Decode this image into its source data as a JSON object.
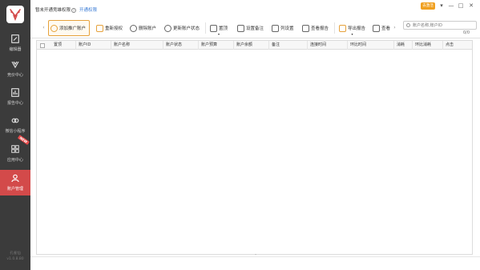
{
  "sidebar": {
    "items": [
      {
        "label": "编辑器",
        "icon": "edit-icon"
      },
      {
        "label": "竞价中心",
        "icon": "bid-icon"
      },
      {
        "label": "报告中心",
        "icon": "report-icon"
      },
      {
        "label": "微信小程序",
        "icon": "wechat-icon"
      },
      {
        "label": "应用中心",
        "icon": "apps-icon",
        "badge": "NEW"
      },
      {
        "label": "账户管理",
        "icon": "account-icon",
        "active": true
      }
    ],
    "footer_name": "孔雀仙",
    "version": "v1.0.8.80"
  },
  "header": {
    "notice": "暂未开通竞雄权限",
    "notice_link": "开通权限",
    "vip_label": "去激活",
    "window_controls": [
      "▾",
      "—",
      "□",
      "✕"
    ]
  },
  "toolbar": {
    "buttons": [
      {
        "label": "添加推广账户",
        "icon": "user-add-icon"
      },
      {
        "label": "重新授权",
        "icon": "reauth-icon"
      },
      {
        "label": "删除账户",
        "icon": "delete-icon"
      },
      {
        "label": "更新账户状态",
        "icon": "refresh-icon"
      },
      {
        "label": "置顶",
        "icon": "pin-top-icon"
      },
      {
        "label": "设置备注",
        "icon": "note-icon"
      },
      {
        "label": "列设置",
        "icon": "column-settings-icon"
      },
      {
        "label": "查看报告",
        "icon": "view-report-icon"
      },
      {
        "label": "导出报告",
        "icon": "export-icon"
      },
      {
        "label": "查看",
        "icon": "view-icon"
      }
    ],
    "search_placeholder": "账户名称,账户ID",
    "count": "0/0"
  },
  "table": {
    "columns": [
      "置顶",
      "账户ID",
      "账户名称",
      "账户状态",
      "账户预算",
      "账户余额",
      "备注",
      "连接时间",
      "环比时间",
      "消耗",
      "环比消耗",
      "点击"
    ]
  },
  "colors": {
    "sidebar_bg": "#3b3b3b",
    "active_bg": "#d34a4a",
    "accent": "#e6a23c",
    "link": "#3a7bd5"
  }
}
